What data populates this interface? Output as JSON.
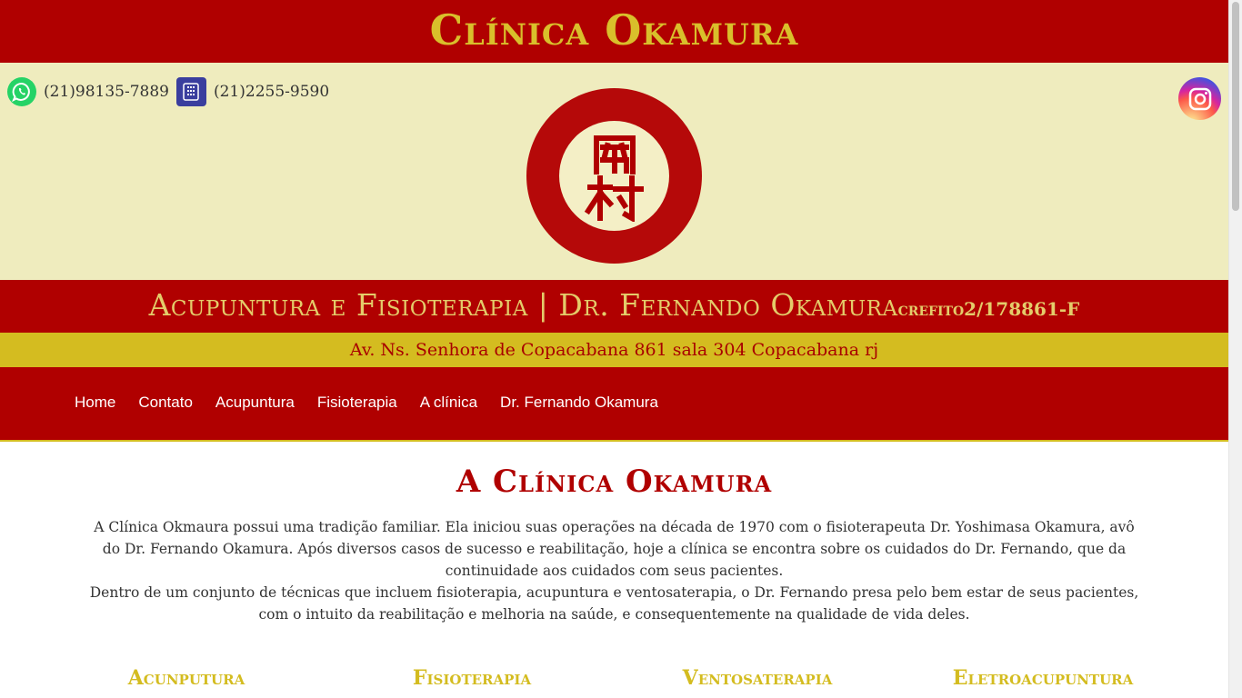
{
  "site": {
    "title": "Clínica Okamura"
  },
  "contacts": {
    "whatsapp": "(21)98135-7889",
    "phone": "(21)2255-9590"
  },
  "logo": {
    "chars": "岡村"
  },
  "subtitle": {
    "text": "Acupuntura e Fisioterapia | Dr. Fernando Okamura",
    "crefito": "crefito2/178861-F"
  },
  "address": "Av. Ns. Senhora de Copacabana 861 sala 304 Copacabana rj",
  "nav": [
    "Home",
    "Contato",
    "Acupuntura",
    "Fisioterapia",
    "A clínica",
    "Dr. Fernando Okamura"
  ],
  "main": {
    "title": "A Clínica Okamura",
    "paragraphs": [
      "A Clínica Okmaura possui uma tradição familiar. Ela iniciou suas operações na década de 1970 com o fisioterapeuta Dr. Yoshimasa Okamura, avô do Dr. Fernando Okamura. Após diversos casos de sucesso e reabilitação, hoje a clínica se encontra sobre os cuidados do Dr. Fernando, que da continuidade aos cuidados com seus pacientes.",
      "Dentro de um conjunto de técnicas que incluem fisioterapia, acupuntura e ventosaterapia, o Dr. Fernando presa pelo bem estar de seus pacientes, com o intuito da reabilitação e melhoria na saúde, e consequentemente na qualidade de vida deles."
    ]
  },
  "services": [
    "Acunputura",
    "Fisioterapia",
    "Ventosaterapia",
    "Eletroacupuntura"
  ],
  "colors": {
    "brand_red": "#b00000",
    "gold": "#d4bc20",
    "cream": "#efecbe"
  },
  "icons": [
    "whatsapp-icon",
    "phone-icon",
    "instagram-icon"
  ]
}
